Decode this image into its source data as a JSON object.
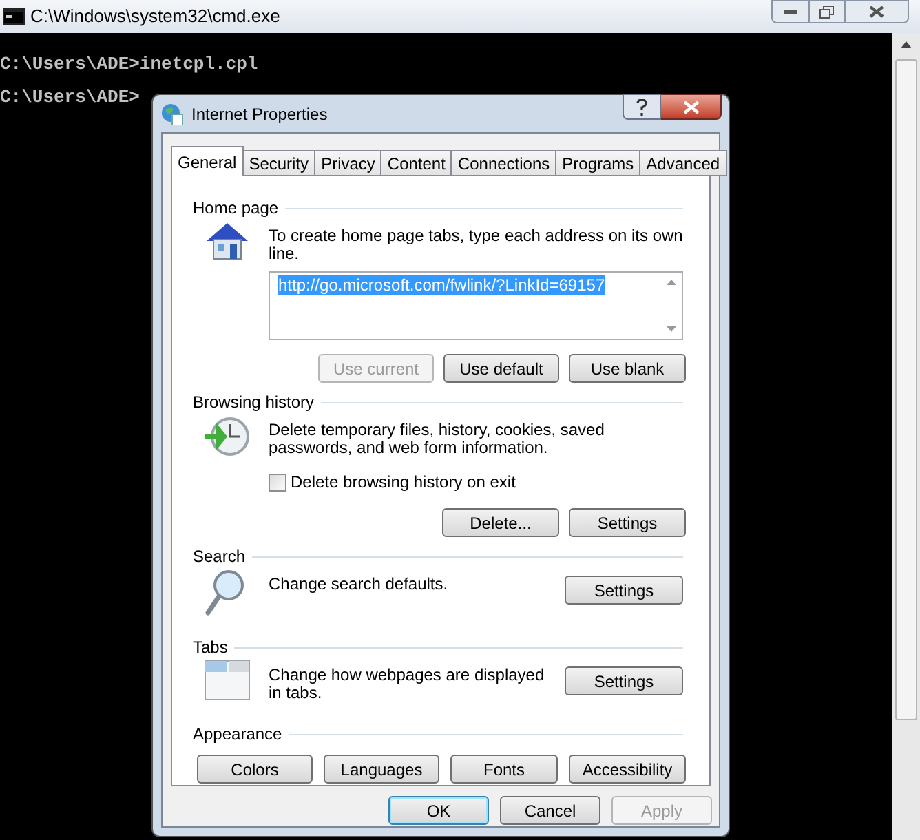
{
  "console": {
    "title": "C:\\Windows\\system32\\cmd.exe",
    "lines": [
      "C:\\Users\\ADE>inetcpl.cpl",
      "C:\\Users\\ADE>"
    ]
  },
  "dialog": {
    "title": "Internet Properties",
    "tabs": [
      {
        "label": "General",
        "selected": true
      },
      {
        "label": "Security",
        "selected": false
      },
      {
        "label": "Privacy",
        "selected": false
      },
      {
        "label": "Content",
        "selected": false
      },
      {
        "label": "Connections",
        "selected": false
      },
      {
        "label": "Programs",
        "selected": false
      },
      {
        "label": "Advanced",
        "selected": false
      }
    ],
    "sections": [
      {
        "kind": "home",
        "heading": "Home page",
        "description": "To create home page tabs, type each address on its own line.",
        "url": "http://go.microsoft.com/fwlink/?LinkId=69157",
        "buttons": [
          {
            "label": "Use current",
            "disabled": true
          },
          {
            "label": "Use default",
            "disabled": false
          },
          {
            "label": "Use blank",
            "disabled": false
          }
        ]
      },
      {
        "kind": "history",
        "heading": "Browsing history",
        "description": "Delete temporary files, history, cookies, saved passwords, and web form information.",
        "checkbox": {
          "label": "Delete browsing history on exit",
          "checked": false
        },
        "buttons": [
          {
            "label": "Delete...",
            "disabled": false
          },
          {
            "label": "Settings",
            "disabled": false
          }
        ]
      },
      {
        "kind": "search",
        "heading": "Search",
        "description": "Change search defaults.",
        "buttons": [
          {
            "label": "Settings",
            "disabled": false
          }
        ]
      },
      {
        "kind": "tabs",
        "heading": "Tabs",
        "description": "Change how webpages are displayed in tabs.",
        "buttons": [
          {
            "label": "Settings",
            "disabled": false
          }
        ]
      },
      {
        "kind": "appearance",
        "heading": "Appearance",
        "buttons": [
          {
            "label": "Colors",
            "disabled": false
          },
          {
            "label": "Languages",
            "disabled": false
          },
          {
            "label": "Fonts",
            "disabled": false
          },
          {
            "label": "Accessibility",
            "disabled": false
          }
        ]
      }
    ],
    "footer_buttons": [
      {
        "label": "OK",
        "disabled": false,
        "default": true
      },
      {
        "label": "Cancel",
        "disabled": false,
        "default": false
      },
      {
        "label": "Apply",
        "disabled": true,
        "default": false
      }
    ]
  }
}
